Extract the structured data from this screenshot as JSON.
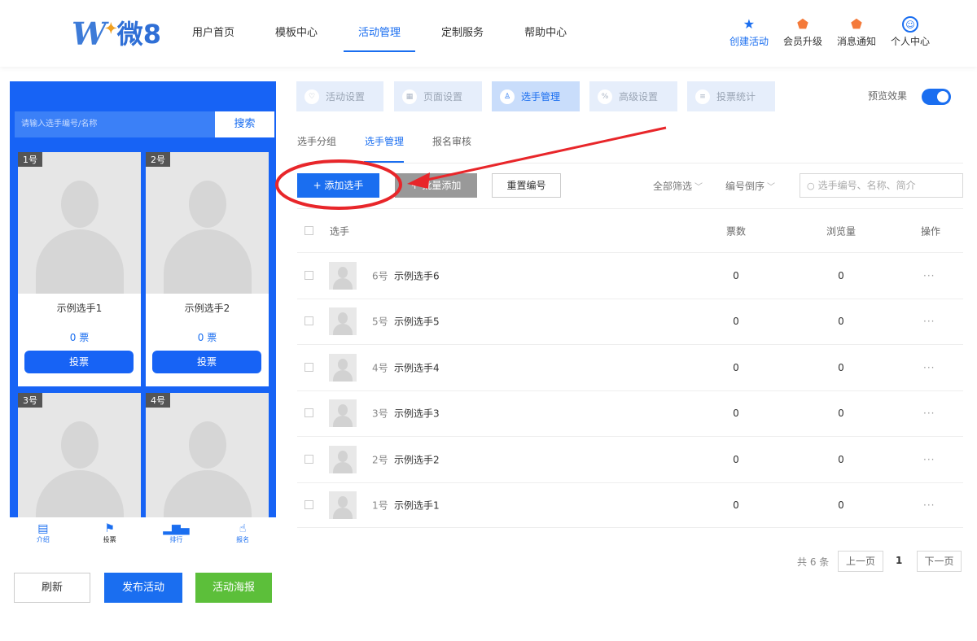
{
  "brand": {
    "logo_mark": "W",
    "logo_text": "微8"
  },
  "nav": [
    {
      "label": "用户首页",
      "active": false
    },
    {
      "label": "模板中心",
      "active": false
    },
    {
      "label": "活动管理",
      "active": true
    },
    {
      "label": "定制服务",
      "active": false
    },
    {
      "label": "帮助中心",
      "active": false
    }
  ],
  "header_actions": [
    {
      "label": "创建活动",
      "icon": "star-icon"
    },
    {
      "label": "会员升级",
      "icon": "vip-shield-icon"
    },
    {
      "label": "消息通知",
      "icon": "notification-shield-icon"
    },
    {
      "label": "个人中心",
      "icon": "user-circle-icon"
    }
  ],
  "phone": {
    "search_placeholder": "请输入选手编号/名称",
    "search_button": "搜索",
    "cards": [
      {
        "num": "1号",
        "name": "示例选手1",
        "votes": "0 票",
        "vote_button": "投票"
      },
      {
        "num": "2号",
        "name": "示例选手2",
        "votes": "0 票",
        "vote_button": "投票"
      },
      {
        "num": "3号"
      },
      {
        "num": "4号"
      }
    ],
    "tabbar": [
      {
        "label": "介绍",
        "icon": "document-icon",
        "active": false
      },
      {
        "label": "投票",
        "icon": "flag-icon",
        "active": true
      },
      {
        "label": "排行",
        "icon": "bar-chart-icon",
        "active": false
      },
      {
        "label": "报名",
        "icon": "hand-pointer-icon",
        "active": false
      }
    ]
  },
  "bottom_buttons": {
    "refresh": "刷新",
    "publish": "发布活动",
    "poster": "活动海报"
  },
  "setting_tabs": [
    {
      "label": "活动设置",
      "icon": "heart-icon",
      "active": false
    },
    {
      "label": "页面设置",
      "icon": "page-icon",
      "active": false
    },
    {
      "label": "选手管理",
      "icon": "person-icon",
      "active": true
    },
    {
      "label": "高级设置",
      "icon": "advanced-icon",
      "active": false
    },
    {
      "label": "投票统计",
      "icon": "stats-icon",
      "active": false
    }
  ],
  "preview": {
    "label": "预览效果",
    "enabled": true
  },
  "sub_tabs": [
    {
      "label": "选手分组",
      "active": false
    },
    {
      "label": "选手管理",
      "active": true
    },
    {
      "label": "报名审核",
      "active": false
    }
  ],
  "toolbar": {
    "add": "+ 添加选手",
    "batch": "+ 批量添加",
    "renumber": "重置编号",
    "filter_all": "全部筛选",
    "sort": "编号倒序",
    "search_placeholder": "选手编号、名称、简介"
  },
  "table": {
    "headers": {
      "player": "选手",
      "votes": "票数",
      "views": "浏览量",
      "ops": "操作"
    },
    "rows": [
      {
        "num": "6号",
        "name": "示例选手6",
        "votes": "0",
        "views": "0",
        "more": "···"
      },
      {
        "num": "5号",
        "name": "示例选手5",
        "votes": "0",
        "views": "0",
        "more": "···"
      },
      {
        "num": "4号",
        "name": "示例选手4",
        "votes": "0",
        "views": "0",
        "more": "···"
      },
      {
        "num": "3号",
        "name": "示例选手3",
        "votes": "0",
        "views": "0",
        "more": "···"
      },
      {
        "num": "2号",
        "name": "示例选手2",
        "votes": "0",
        "views": "0",
        "more": "···"
      },
      {
        "num": "1号",
        "name": "示例选手1",
        "votes": "0",
        "views": "0",
        "more": "···"
      }
    ]
  },
  "pagination": {
    "total": "共 6 条",
    "prev": "上一页",
    "current": "1",
    "next": "下一页"
  },
  "colors": {
    "accent": "#1a6ef0",
    "phone_bg": "#1763f5",
    "green": "#5cbf3a",
    "annotation": "#e8262a"
  }
}
